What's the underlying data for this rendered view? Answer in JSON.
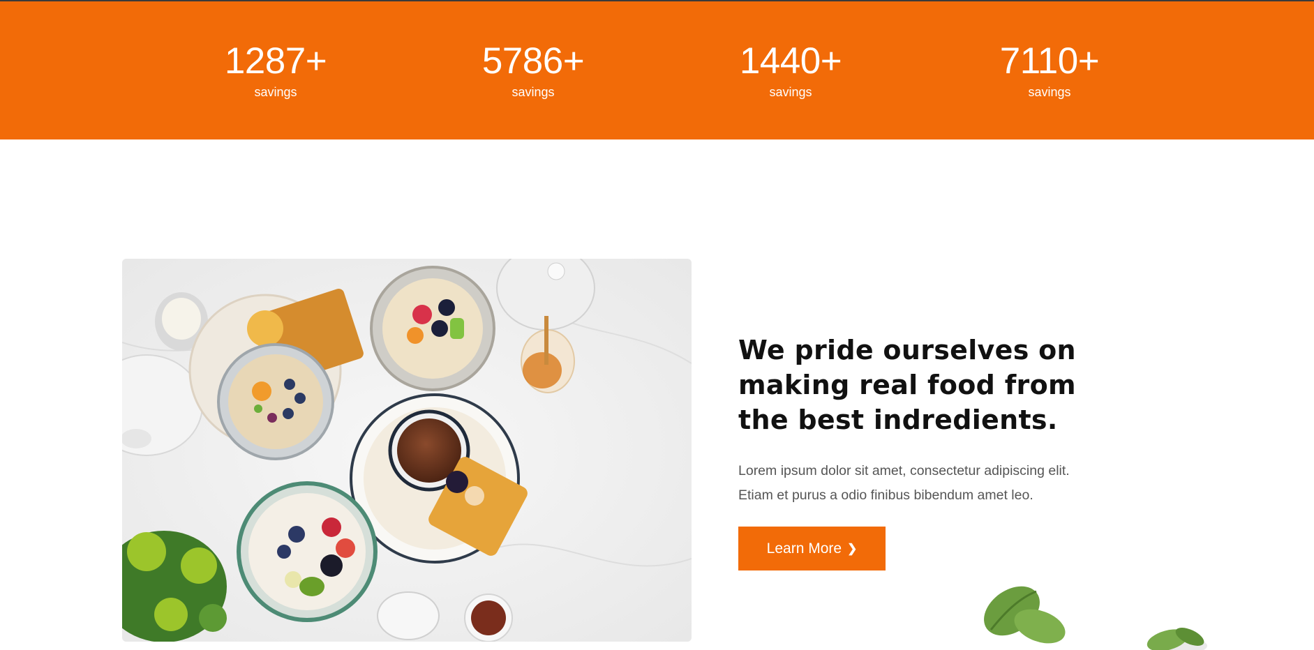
{
  "stats": [
    {
      "value": "1287+",
      "label": "savings"
    },
    {
      "value": "5786+",
      "label": "savings"
    },
    {
      "value": "1440+",
      "label": "savings"
    },
    {
      "value": "7110+",
      "label": "savings"
    }
  ],
  "about": {
    "heading": "We pride ourselves on making real food from the best indredients.",
    "body_line_1": "Lorem ipsum dolor sit amet, consectetur adipiscing elit.",
    "body_line_2": "Etiam et purus a odio finibus bibendum amet leo.",
    "button_label": "Learn More",
    "button_icon": "chevron-right-icon"
  },
  "colors": {
    "accent": "#f26b08",
    "heading": "#111111",
    "body": "#555555",
    "background": "#ffffff"
  }
}
